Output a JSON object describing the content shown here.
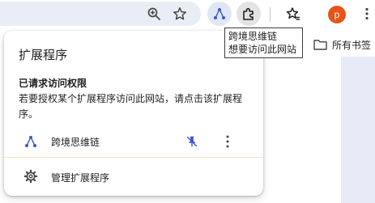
{
  "colors": {
    "omnibox_bg": "#e9eef6",
    "avatar_bg": "#e65418",
    "extension_accent": "#3d57c4",
    "page_strip": "#e8eaf7",
    "divider": "#f3e4bf"
  },
  "toolbar": {
    "zoom_icon": "zoom-in-icon",
    "bookmark_star_icon": "star-icon",
    "extension_app_icon": "mind-map-extension-icon",
    "extensions_menu_icon": "puzzle-piece-icon",
    "reading_list_icon": "star-list-icon",
    "profile_initial": "p",
    "more_icon": "vertical-dots-icon"
  },
  "bookmarks_bar": {
    "folder_label": "所有书签"
  },
  "tooltip": {
    "line1": "跨境思维链",
    "line2": "想要访问此网站"
  },
  "extensions_popup": {
    "title": "扩展程序",
    "section_heading": "已请求访问权限",
    "section_description": "若要授权某个扩展程序访问此网站，请点击该扩展程序。",
    "extension": {
      "name": "跨境思维链",
      "icon": "mind-map-extension-icon",
      "pin_icon": "unpin-icon",
      "more_icon": "vertical-dots-icon"
    },
    "manage": {
      "label": "管理扩展程序",
      "icon": "gear-icon"
    }
  }
}
